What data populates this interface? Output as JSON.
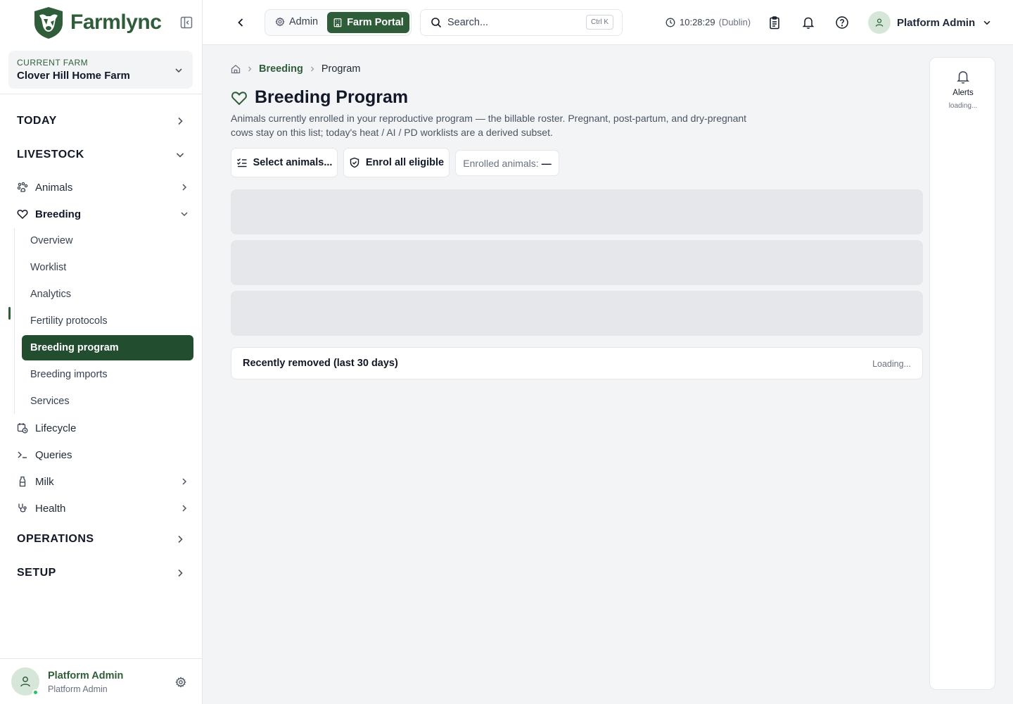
{
  "app": {
    "name": "Farmlync"
  },
  "farm": {
    "label": "CURRENT FARM",
    "name": "Clover Hill Home Farm"
  },
  "sidebar": {
    "sections": {
      "today": "TODAY",
      "livestock": "LIVESTOCK",
      "operations": "OPERATIONS",
      "setup": "SETUP"
    },
    "items": {
      "animals": "Animals",
      "breeding": "Breeding",
      "lifecycle": "Lifecycle",
      "queries": "Queries",
      "milk": "Milk",
      "health": "Health"
    },
    "breeding_sub": [
      "Overview",
      "Worklist",
      "Analytics",
      "Fertility protocols",
      "Breeding program",
      "Breeding imports",
      "Services"
    ],
    "active_sub": "Breeding program"
  },
  "user": {
    "name": "Platform Admin",
    "role": "Platform Admin"
  },
  "header": {
    "admin_label": "Admin",
    "farm_portal_label": "Farm Portal",
    "search_placeholder": "Search...",
    "search_shortcut": "Ctrl K",
    "time": "10:28:29",
    "timezone": "(Dublin)",
    "user_name": "Platform Admin"
  },
  "breadcrumb": {
    "parent": "Breeding",
    "current": "Program"
  },
  "page": {
    "title": "Breeding Program",
    "description": "Animals currently enrolled in your reproductive program — the billable roster. Pregnant, post-partum, and dry-pregnant cows stay on this list; today's heat / AI / PD worklists are a derived subset."
  },
  "actions": {
    "select_label": "Select animals...",
    "enrol_label": "Enrol all eligible",
    "enrolled_label": "Enrolled animals:",
    "enrolled_value": "—"
  },
  "removed": {
    "title": "Recently removed (last 30 days)",
    "status": "Loading..."
  },
  "alerts": {
    "title": "Alerts",
    "status": "loading..."
  },
  "colors": {
    "brand": "#2f5d3a",
    "active_bg": "#234d2f",
    "skeleton": "#e5e7eb"
  }
}
